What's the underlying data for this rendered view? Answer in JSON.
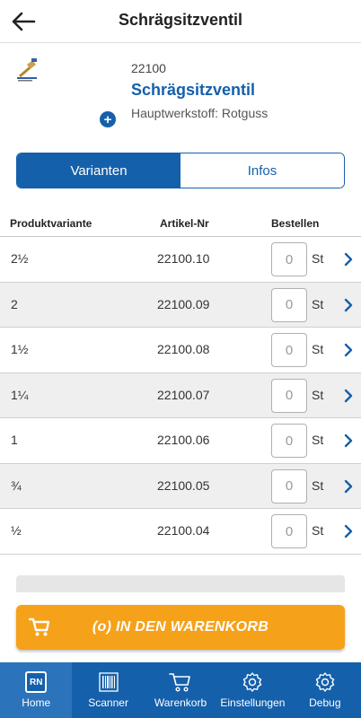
{
  "header": {
    "title": "Schrägsitzventil",
    "back_icon": "arrow-left-icon"
  },
  "product": {
    "number": "22100",
    "name": "Schrägsitzventil",
    "material": "Hauptwerkstoff: Rotguss",
    "add_icon": "plus-circle-icon"
  },
  "tabs": {
    "variants": "Varianten",
    "infos": "Infos",
    "active": "variants"
  },
  "table": {
    "headers": {
      "variant": "Produktvariante",
      "artikel": "Artikel-Nr",
      "order": "Bestellen"
    },
    "rows": [
      {
        "variant": "2½",
        "artikel": "22100.10",
        "qty": "0",
        "unit": "St"
      },
      {
        "variant": "2",
        "artikel": "22100.09",
        "qty": "0",
        "unit": "St"
      },
      {
        "variant": "1½",
        "artikel": "22100.08",
        "qty": "0",
        "unit": "St"
      },
      {
        "variant": "1¼",
        "artikel": "22100.07",
        "qty": "0",
        "unit": "St"
      },
      {
        "variant": "1",
        "artikel": "22100.06",
        "qty": "0",
        "unit": "St"
      },
      {
        "variant": "¾",
        "artikel": "22100.05",
        "qty": "0",
        "unit": "St"
      },
      {
        "variant": "½",
        "artikel": "22100.04",
        "qty": "0",
        "unit": "St"
      }
    ]
  },
  "cart_button": {
    "label": "(o) IN DEN WARENKORB",
    "icon": "cart-icon"
  },
  "bottom_nav": [
    {
      "label": "Home",
      "icon": "rn-logo-icon",
      "active": true
    },
    {
      "label": "Scanner",
      "icon": "barcode-icon",
      "active": false
    },
    {
      "label": "Warenkorb",
      "icon": "cart-icon",
      "active": false
    },
    {
      "label": "Einstellungen",
      "icon": "gear-icon",
      "active": false
    },
    {
      "label": "Debug",
      "icon": "gear-icon",
      "active": false
    }
  ],
  "colors": {
    "primary": "#1560aa",
    "accent": "#f6a11a",
    "row_alt": "#efefef"
  }
}
